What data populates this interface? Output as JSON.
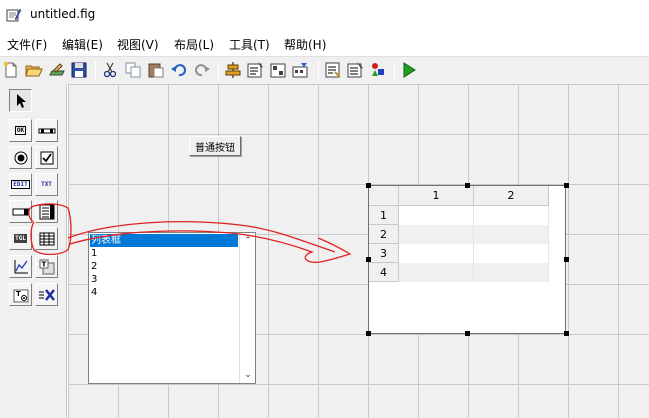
{
  "window": {
    "title": "untitled.fig",
    "icon": "figure-app-icon"
  },
  "menubar": {
    "items": [
      {
        "label": "文件(F)"
      },
      {
        "label": "编辑(E)"
      },
      {
        "label": "视图(V)"
      },
      {
        "label": "布局(L)"
      },
      {
        "label": "工具(T)"
      },
      {
        "label": "帮助(H)"
      }
    ]
  },
  "toolbar": {
    "buttons": [
      "new-icon",
      "open-icon",
      "edit-icon",
      "save-icon",
      "cut-icon",
      "copy-icon",
      "paste-icon",
      "undo-icon",
      "redo-icon",
      "align-icon",
      "menu-editor-icon",
      "tab-order-icon",
      "toolbar-editor-icon",
      "editor-icon",
      "property-inspector-icon",
      "object-browser-icon",
      "run-icon"
    ]
  },
  "palette": {
    "tools": [
      {
        "name": "select-arrow-icon",
        "glyph": ""
      },
      {
        "name": "push-button-tool",
        "glyph": "OK"
      },
      {
        "name": "slider-tool",
        "glyph": "▭"
      },
      {
        "name": "radio-button-tool",
        "glyph": ""
      },
      {
        "name": "checkbox-tool",
        "glyph": ""
      },
      {
        "name": "edit-text-tool",
        "glyph": "EDIT"
      },
      {
        "name": "static-text-tool",
        "glyph": "TXT"
      },
      {
        "name": "popup-menu-tool",
        "glyph": "▭"
      },
      {
        "name": "listbox-tool",
        "glyph": ""
      },
      {
        "name": "toggle-button-tool",
        "glyph": "TGL"
      },
      {
        "name": "table-tool",
        "glyph": ""
      },
      {
        "name": "axes-tool",
        "glyph": ""
      },
      {
        "name": "panel-tool",
        "glyph": "T"
      },
      {
        "name": "button-group-tool",
        "glyph": "T"
      },
      {
        "name": "activex-tool",
        "glyph": "X"
      }
    ]
  },
  "canvas": {
    "push_button": {
      "label": "普通按钮"
    },
    "listbox": {
      "items": [
        "列表框",
        "1",
        "2",
        "3",
        "4"
      ],
      "selected_index": 0,
      "scroll_up": "⌃",
      "scroll_down": "⌄"
    },
    "table": {
      "column_headers": [
        "1",
        "2"
      ],
      "row_headers": [
        "1",
        "2",
        "3",
        "4"
      ]
    }
  },
  "colors": {
    "annotation": "#e02020",
    "selection": "#0078d7",
    "grid": "#c8c8c8",
    "canvas_bg": "#f0f0f0"
  }
}
